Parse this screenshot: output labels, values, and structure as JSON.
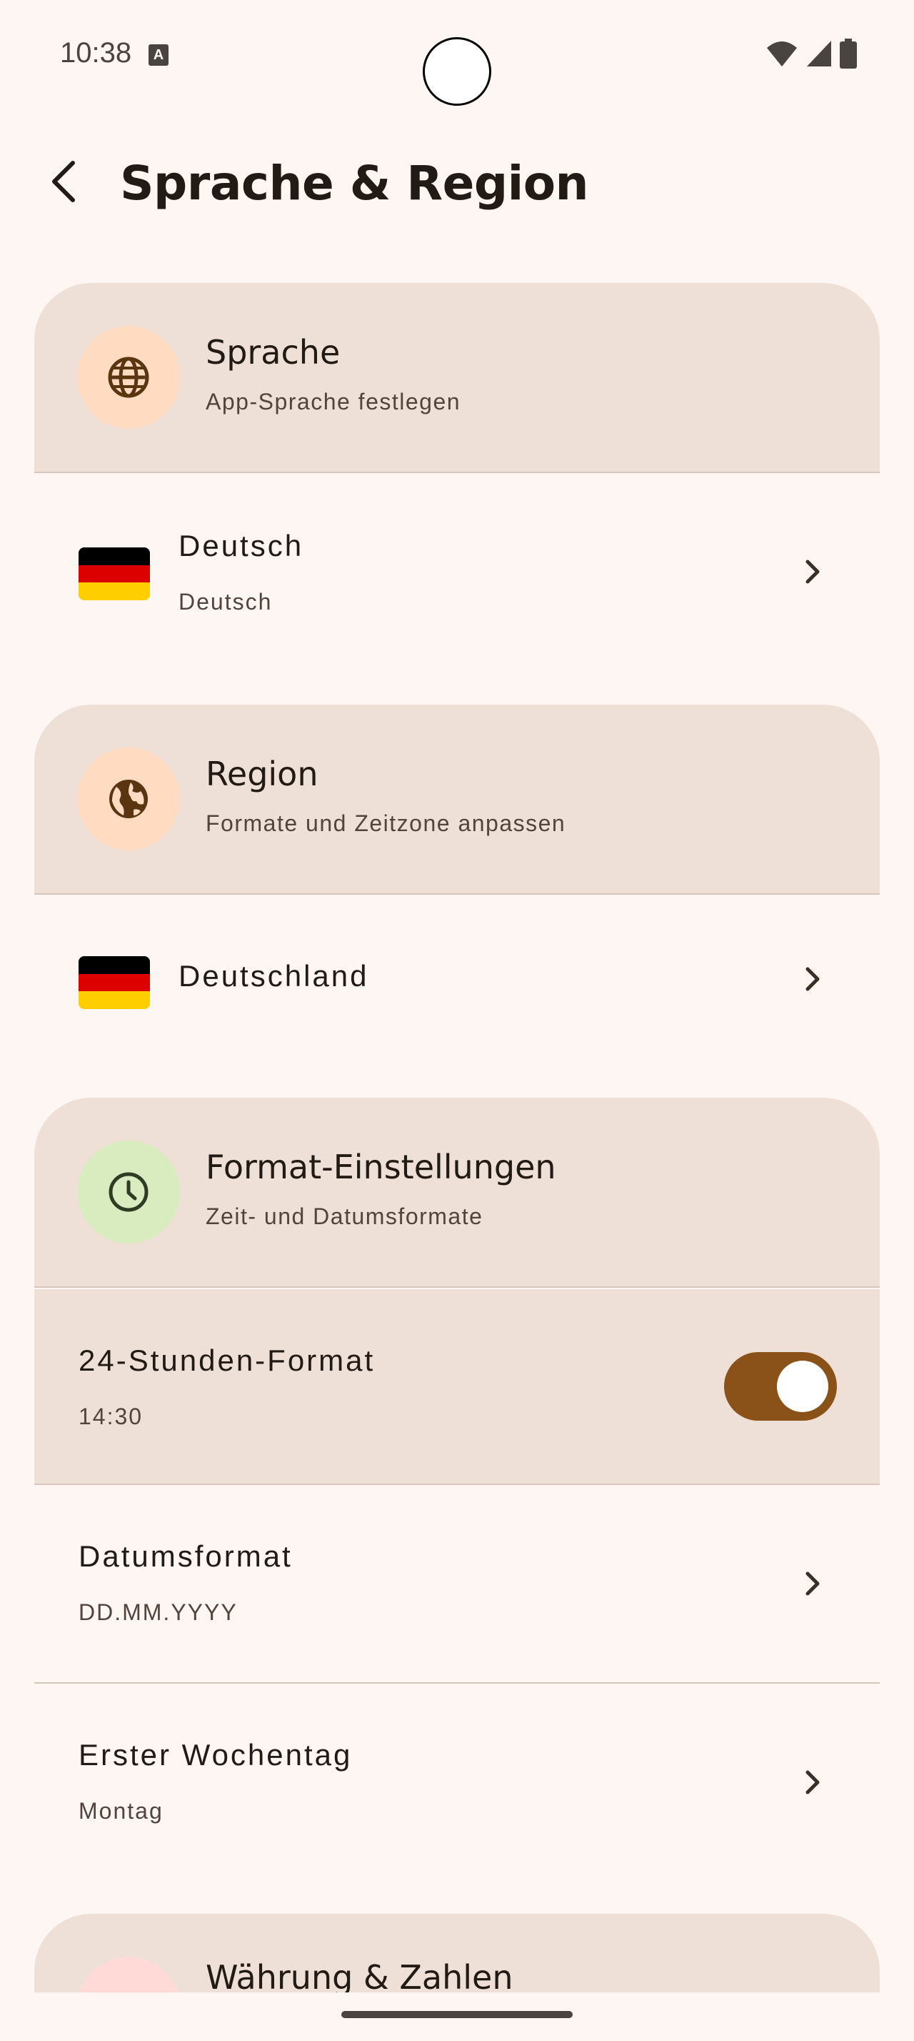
{
  "status_bar": {
    "time": "10:38",
    "notification_icon": "A"
  },
  "app_bar": {
    "back_icon": "arrow-back-icon",
    "title": "Sprache & Region"
  },
  "sections": {
    "language": {
      "title": "Sprache",
      "subtitle": "App-Sprache festlegen",
      "icon": "globe-icon",
      "icon_bg": "#ffdbc1",
      "row": {
        "title": "Deutsch",
        "subtitle": "Deutsch",
        "flag": "de-flag"
      }
    },
    "region": {
      "title": "Region",
      "subtitle": "Formate und Zeitzone anpassen",
      "icon": "earth-icon",
      "icon_bg": "#ffdbc1",
      "row": {
        "title": "Deutschland",
        "flag": "de-flag"
      }
    },
    "format": {
      "title": "Format-Einstellungen",
      "subtitle": "Zeit- und Datumsformate",
      "icon": "clock-icon",
      "icon_bg": "#d8ecc0",
      "rows": {
        "time24": {
          "title": "24-Stunden-Format",
          "subtitle": "14:30",
          "enabled": true
        },
        "date_format": {
          "title": "Datumsformat",
          "subtitle": "DD.MM.YYYY"
        },
        "first_weekday": {
          "title": "Erster Wochentag",
          "subtitle": "Montag"
        }
      }
    },
    "currency": {
      "title": "Währung & Zahlen"
    }
  },
  "colors": {
    "background": "#fdf6f3",
    "card": "#eee0d6",
    "accent": "#8a5119"
  }
}
